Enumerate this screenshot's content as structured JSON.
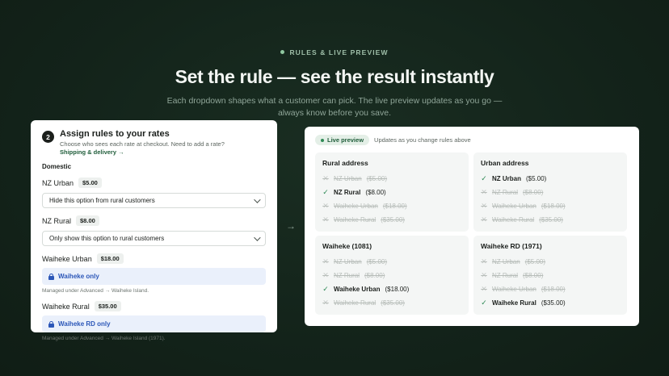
{
  "hero": {
    "eyebrow": "RULES & LIVE PREVIEW",
    "headline": "Set the rule — see the result instantly",
    "sub": "Each dropdown shapes what a customer can pick. The live preview updates as you go — always know before you save."
  },
  "rules_card": {
    "step": "2",
    "title": "Assign rules to your rates",
    "desc": "Choose who sees each rate at checkout. Need to add a rate?",
    "link": "Shipping & delivery →",
    "section": "Domestic",
    "rates": [
      {
        "name": "NZ Urban",
        "price": "$5.00",
        "control": "select",
        "value": "Hide this option from rural customers"
      },
      {
        "name": "NZ Rural",
        "price": "$8.00",
        "control": "select",
        "value": "Only show this option to rural customers"
      },
      {
        "name": "Waiheke Urban",
        "price": "$18.00",
        "control": "locked",
        "value": "Waiheke only",
        "note": "Managed under Advanced → Waiheke Island."
      },
      {
        "name": "Waiheke Rural",
        "price": "$35.00",
        "control": "locked",
        "value": "Waiheke RD only",
        "note": "Managed under Advanced → Waiheke Island (1971)."
      }
    ]
  },
  "arrow": "→",
  "preview": {
    "pill": "Live preview",
    "note": "Updates as you change rules above",
    "addresses": [
      {
        "title": "Rural address",
        "options": [
          {
            "label": "NZ Urban",
            "price": "($5.00)",
            "shown": false
          },
          {
            "label": "NZ Rural",
            "price": "($8.00)",
            "shown": true
          },
          {
            "label": "Waiheke Urban",
            "price": "($18.00)",
            "shown": false
          },
          {
            "label": "Waiheke Rural",
            "price": "($35.00)",
            "shown": false
          }
        ]
      },
      {
        "title": "Urban address",
        "options": [
          {
            "label": "NZ Urban",
            "price": "($5.00)",
            "shown": true
          },
          {
            "label": "NZ Rural",
            "price": "($8.00)",
            "shown": false
          },
          {
            "label": "Waiheke Urban",
            "price": "($18.00)",
            "shown": false
          },
          {
            "label": "Waiheke Rural",
            "price": "($35.00)",
            "shown": false
          }
        ]
      },
      {
        "title": "Waiheke (1081)",
        "options": [
          {
            "label": "NZ Urban",
            "price": "($5.00)",
            "shown": false
          },
          {
            "label": "NZ Rural",
            "price": "($8.00)",
            "shown": false
          },
          {
            "label": "Waiheke Urban",
            "price": "($18.00)",
            "shown": true
          },
          {
            "label": "Waiheke Rural",
            "price": "($35.00)",
            "shown": false
          }
        ]
      },
      {
        "title": "Waiheke RD (1971)",
        "options": [
          {
            "label": "NZ Urban",
            "price": "($5.00)",
            "shown": false
          },
          {
            "label": "NZ Rural",
            "price": "($8.00)",
            "shown": false
          },
          {
            "label": "Waiheke Urban",
            "price": "($18.00)",
            "shown": false
          },
          {
            "label": "Waiheke Rural",
            "price": "($35.00)",
            "shown": true
          }
        ]
      }
    ]
  }
}
